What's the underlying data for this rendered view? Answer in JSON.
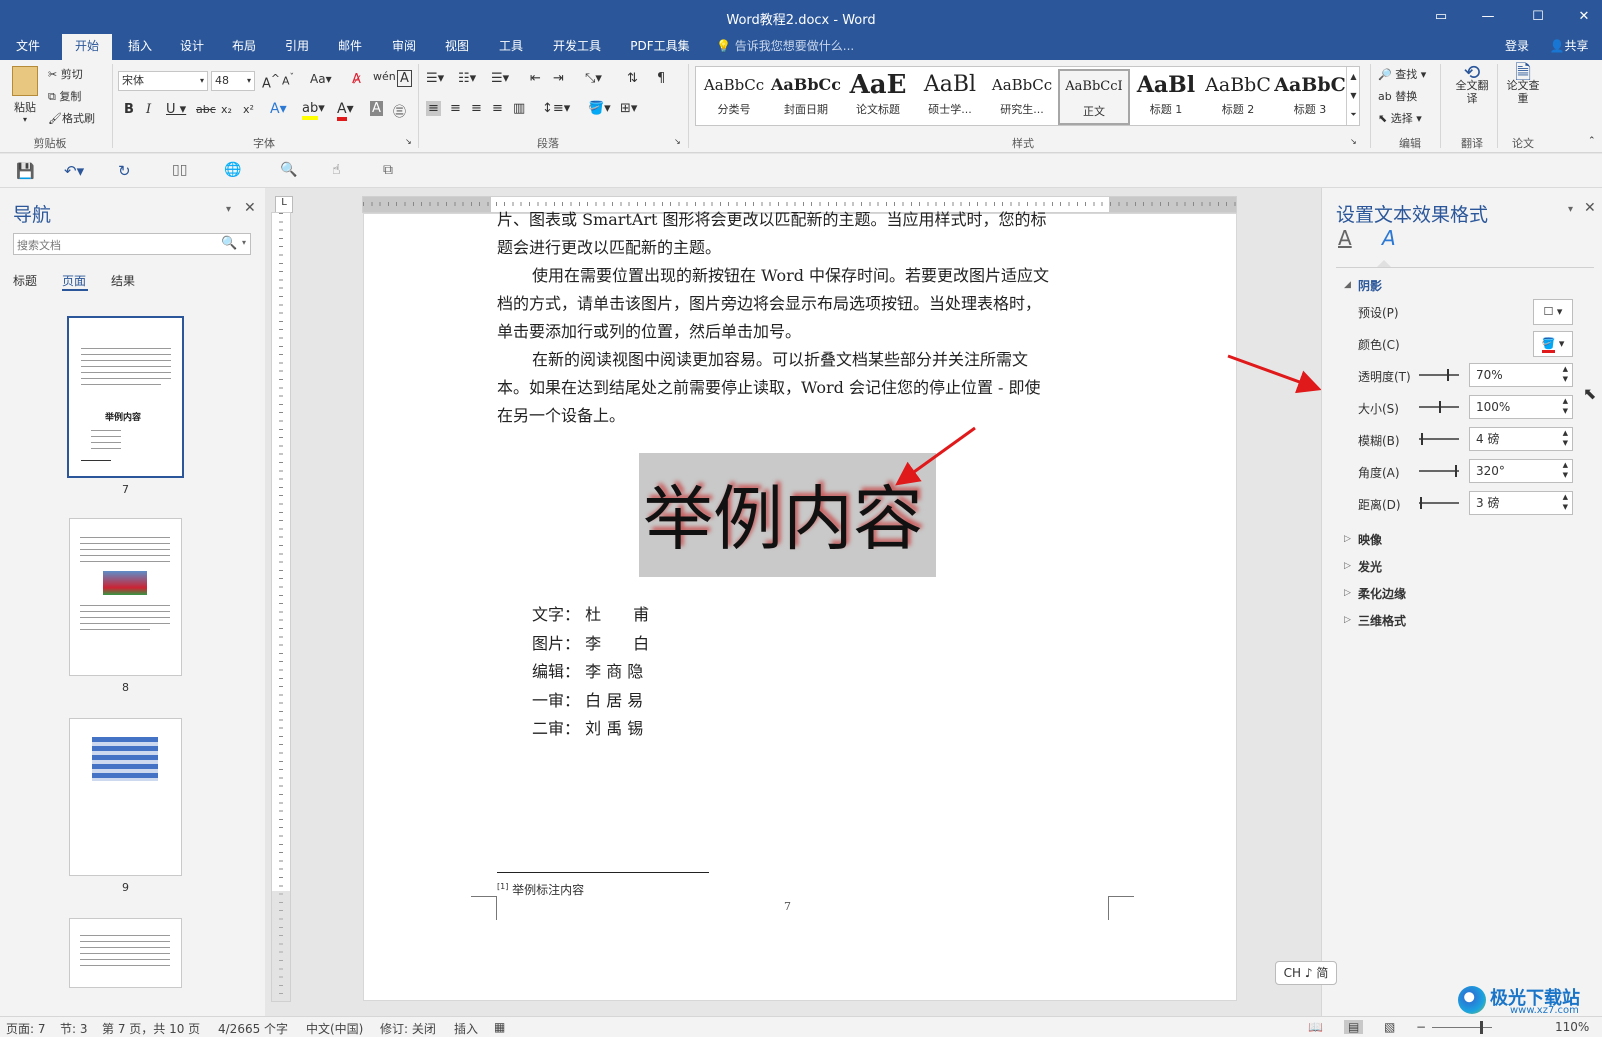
{
  "window": {
    "title": "Word教程2.docx - Word"
  },
  "tabs": [
    "文件",
    "开始",
    "插入",
    "设计",
    "布局",
    "引用",
    "邮件",
    "审阅",
    "视图",
    "工具",
    "开发工具",
    "PDF工具集"
  ],
  "active_tab": "开始",
  "tellme": "告诉我您想要做什么...",
  "account": {
    "login": "登录",
    "share": "共享"
  },
  "clipboard": {
    "paste": "粘贴",
    "cut": "剪切",
    "copy": "复制",
    "format_painter": "格式刷",
    "label": "剪贴板"
  },
  "font": {
    "name": "宋体",
    "size": "48",
    "label": "字体"
  },
  "paragraph": {
    "label": "段落"
  },
  "styles": {
    "label": "样式",
    "items": [
      {
        "preview": "AaBbCc",
        "name": "分类号"
      },
      {
        "preview": "AaBbCc",
        "name": "封面日期"
      },
      {
        "preview": "AaE",
        "name": "论文标题"
      },
      {
        "preview": "AaBl",
        "name": "硕士学..."
      },
      {
        "preview": "AaBbCc",
        "name": "研究生..."
      },
      {
        "preview": "AaBbCcI",
        "name": "正文"
      },
      {
        "preview": "AaBl",
        "name": "标题 1"
      },
      {
        "preview": "AaBbC",
        "name": "标题 2"
      },
      {
        "preview": "AaBbC",
        "name": "标题 3"
      }
    ]
  },
  "editing": {
    "find": "查找",
    "replace": "替换",
    "select": "选择",
    "label": "编辑"
  },
  "translate": {
    "btn": "全文翻译",
    "label": "翻译"
  },
  "paper": {
    "btn": "论文查重",
    "label": "论文"
  },
  "navigation": {
    "title": "导航",
    "search_placeholder": "搜索文档",
    "tabs": [
      "标题",
      "页面",
      "结果"
    ],
    "active_tab": "页面",
    "pages": [
      "7",
      "8",
      "9"
    ]
  },
  "document": {
    "lines": [
      "片、图表或 SmartArt 图形将会更改以匹配新的主题。当应用样式时，您的标",
      "题会进行更改以匹配新的主题。",
      "使用在需要位置出现的新按钮在 Word 中保存时间。若要更改图片适应文",
      "档的方式，请单击该图片，图片旁边将会显示布局选项按钮。当处理表格时，",
      "单击要添加行或列的位置，然后单击加号。",
      "在新的阅读视图中阅读更加容易。可以折叠文档某些部分并关注所需文",
      "本。如果在达到结尾处之前需要停止读取，Word 会记住您的停止位置 - 即使",
      "在另一个设备上。"
    ],
    "heading": "举例内容",
    "credits": [
      {
        "role": "文字：",
        "name": "杜　　甫"
      },
      {
        "role": "图片：",
        "name": "李　　白"
      },
      {
        "role": "编辑：",
        "name": "李 商 隐"
      },
      {
        "role": "一审：",
        "name": "白 居 易"
      },
      {
        "role": "二审：",
        "name": "刘 禹 锡"
      }
    ],
    "footnote_mark": "[1]",
    "footnote": "举例标注内容",
    "page_number": "7"
  },
  "format_pane": {
    "title": "设置文本效果格式",
    "sections": {
      "shadow": "阴影",
      "reflection": "映像",
      "glow": "发光",
      "soft_edges": "柔化边缘",
      "three_d": "三维格式"
    },
    "props": [
      {
        "label": "预设(P)",
        "value": ""
      },
      {
        "label": "颜色(C)",
        "value": ""
      },
      {
        "label": "透明度(T)",
        "value": "70%"
      },
      {
        "label": "大小(S)",
        "value": "100%"
      },
      {
        "label": "模糊(B)",
        "value": "4 磅"
      },
      {
        "label": "角度(A)",
        "value": "320°"
      },
      {
        "label": "距离(D)",
        "value": "3 磅"
      }
    ]
  },
  "ime": "CH ♪ 简",
  "status": {
    "page": "页面: 7",
    "section": "节: 3",
    "pages": "第 7 页，共 10 页",
    "words": "4/2665 个字",
    "lang": "中文(中国)",
    "track": "修订: 关闭",
    "insert": "插入",
    "zoom": "110%"
  },
  "watermark": "极光下载站",
  "watermark_url": "www.xz7.com",
  "colors": {
    "accent": "#2b579a",
    "arrow": "#e0191b",
    "highlight": "#c9c9c9"
  }
}
